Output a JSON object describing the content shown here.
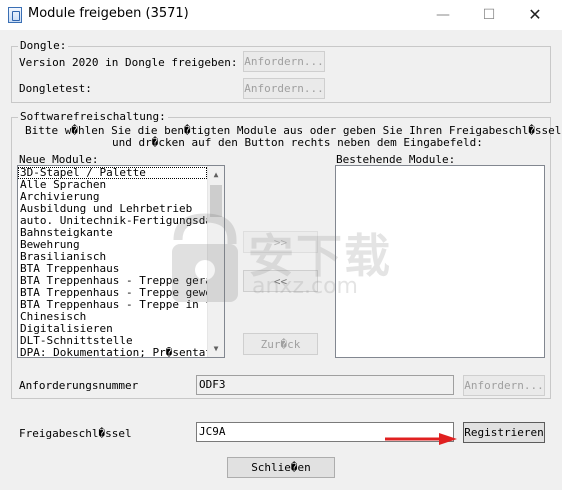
{
  "window": {
    "title": "Module freigeben (3571)",
    "minimize": "—",
    "maximize": "☐",
    "close": "✕"
  },
  "dongle": {
    "group_title": "Dongle:",
    "version_label": "Version 2020 in Dongle freigeben:",
    "version_button": "Anfordern...",
    "test_label": "Dongletest:",
    "test_button": "Anfordern..."
  },
  "software": {
    "group_title": "Softwarefreischaltung:",
    "instruction_line1": "Bitte w�hlen Sie die ben�tigten Module aus oder geben Sie Ihren Freigabeschl�ssel ein",
    "instruction_line2": "und dr�cken auf den Button rechts neben dem Eingabefeld:",
    "new_modules_label": "Neue Module:",
    "existing_modules_label": "Bestehende Module:",
    "new_modules": [
      "3D-Stapel / Palette",
      "Alle Sprachen",
      "Archivierung",
      "Ausbildung und Lehrbetrieb",
      "auto. Unitechnik-Fertigungsdate",
      "Bahnsteigkante",
      "Bewehrung",
      "Brasilianisch",
      "BTA Treppenhaus",
      "BTA Treppenhaus - Treppe gerade",
      "BTA Treppenhaus - Treppe gewend",
      "BTA Treppenhaus - Treppe in fes",
      "Chinesisch",
      "Digitalisieren",
      "DLT-Schnittstelle",
      "DPA: Dokumentation; Pr�sentatio"
    ],
    "existing_modules": [],
    "add_button": ">>",
    "remove_button": "<<",
    "reset_button": "Zur�ck",
    "request_number_label": "Anforderungsnummer",
    "request_number_value": "ODF3",
    "request_button": "Anfordern..."
  },
  "release": {
    "key_label": "Freigabeschl�ssel",
    "key_value": "JC9A",
    "register_button": "Registrieren"
  },
  "footer": {
    "close_button": "Schlie�en"
  },
  "watermark": {
    "text": "安下载",
    "sub": "anxz.com"
  },
  "colors": {
    "dialog_bg": "#f0f0f0",
    "annotation_arrow": "#e02020"
  }
}
